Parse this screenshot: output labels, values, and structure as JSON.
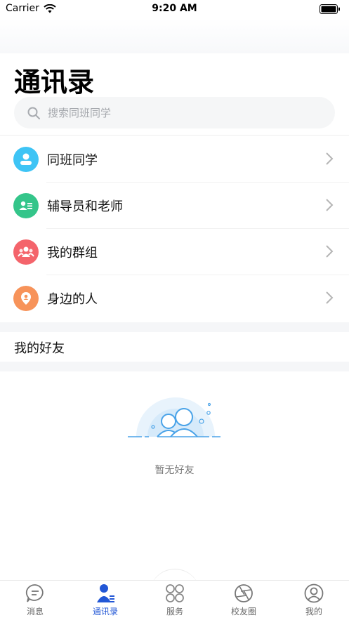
{
  "status_bar": {
    "carrier": "Carrier",
    "time": "9:20 AM"
  },
  "page": {
    "title": "通讯录"
  },
  "search": {
    "placeholder": "搜索同班同学"
  },
  "menu": [
    {
      "label": "同班同学",
      "icon": "classmates-icon",
      "color": "#3ec4f5"
    },
    {
      "label": "辅导员和老师",
      "icon": "teacher-card-icon",
      "color": "#34c58a"
    },
    {
      "label": "我的群组",
      "icon": "group-icon",
      "color": "#f4646b"
    },
    {
      "label": "身边的人",
      "icon": "nearby-location-icon",
      "color": "#f7935a"
    }
  ],
  "friends": {
    "header": "我的好友",
    "empty_text": "暂无好友"
  },
  "tabs": [
    {
      "label": "消息",
      "icon": "message-icon",
      "active": false
    },
    {
      "label": "通讯录",
      "icon": "contacts-icon",
      "active": true
    },
    {
      "label": "服务",
      "icon": "service-clover-icon",
      "active": false
    },
    {
      "label": "校友圈",
      "icon": "camera-aperture-icon",
      "active": false
    },
    {
      "label": "我的",
      "icon": "profile-icon",
      "active": false
    }
  ],
  "colors": {
    "accent": "#2257d6",
    "background_gray": "#f5f6f8"
  }
}
